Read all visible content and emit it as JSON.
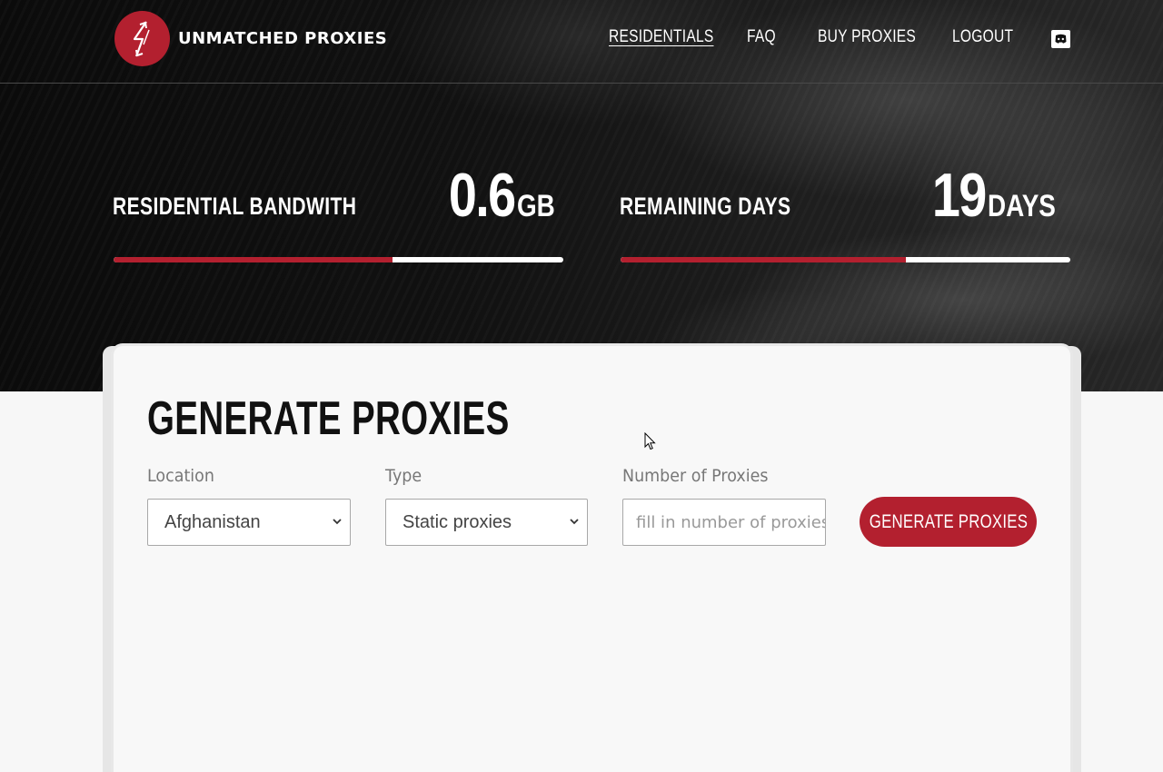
{
  "brand": {
    "name": "UNMATCHED PROXIES",
    "accent_color": "#b3202f"
  },
  "nav": {
    "items": [
      {
        "label": "RESIDENTIALS",
        "active": true
      },
      {
        "label": "FAQ",
        "active": false
      },
      {
        "label": "BUY PROXIES",
        "active": false
      },
      {
        "label": "LOGOUT",
        "active": false
      }
    ],
    "discord_icon": "discord-icon"
  },
  "stats": {
    "bandwidth": {
      "label": "RESIDENTIAL BANDWITH",
      "value": "0.6",
      "unit": "GB",
      "progress_fraction": 0.62
    },
    "days": {
      "label": "REMAINING DAYS",
      "value": "19",
      "unit": "DAYS",
      "progress_fraction": 0.635
    }
  },
  "generator": {
    "title": "GENERATE PROXIES",
    "location": {
      "label": "Location",
      "selected": "Afghanistan"
    },
    "type": {
      "label": "Type",
      "selected": "Static proxies"
    },
    "count": {
      "label": "Number of Proxies",
      "placeholder": "fill in number of proxies",
      "value": ""
    },
    "button_label": "GENERATE PROXIES"
  }
}
